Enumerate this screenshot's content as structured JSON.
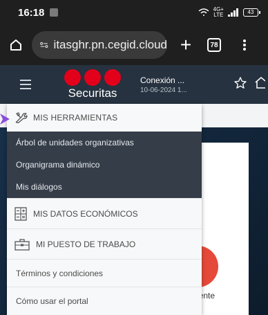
{
  "status_bar": {
    "time": "16:18",
    "net_type": "LTE",
    "net_gen": "4G+",
    "battery": "43"
  },
  "browser": {
    "url": "itasghr.pn.cegid.cloud",
    "tab_count": "78"
  },
  "header": {
    "brand": "Securitas",
    "connection_label": "Conexión ...",
    "connection_date": "10-06-2024 1...",
    "brand_color": "#e3001b"
  },
  "menu": {
    "tools_label": "MIS HERRAMIENTAS",
    "tools_items": [
      {
        "label": "Árbol de unidades organizativas"
      },
      {
        "label": "Organigrama dinámico"
      },
      {
        "label": "Mis diálogos"
      }
    ],
    "economic_label": "MIS DATOS ECONÓMICOS",
    "job_label": "MI PUESTO DE TRABAJO",
    "terms_label": "Términos y condiciones",
    "howto_label": "Cómo usar el portal"
  },
  "background": {
    "partial_text": "rgente"
  },
  "icons": {
    "tools": "tools-icon",
    "economic": "calculator-icon",
    "job": "briefcase-icon"
  }
}
